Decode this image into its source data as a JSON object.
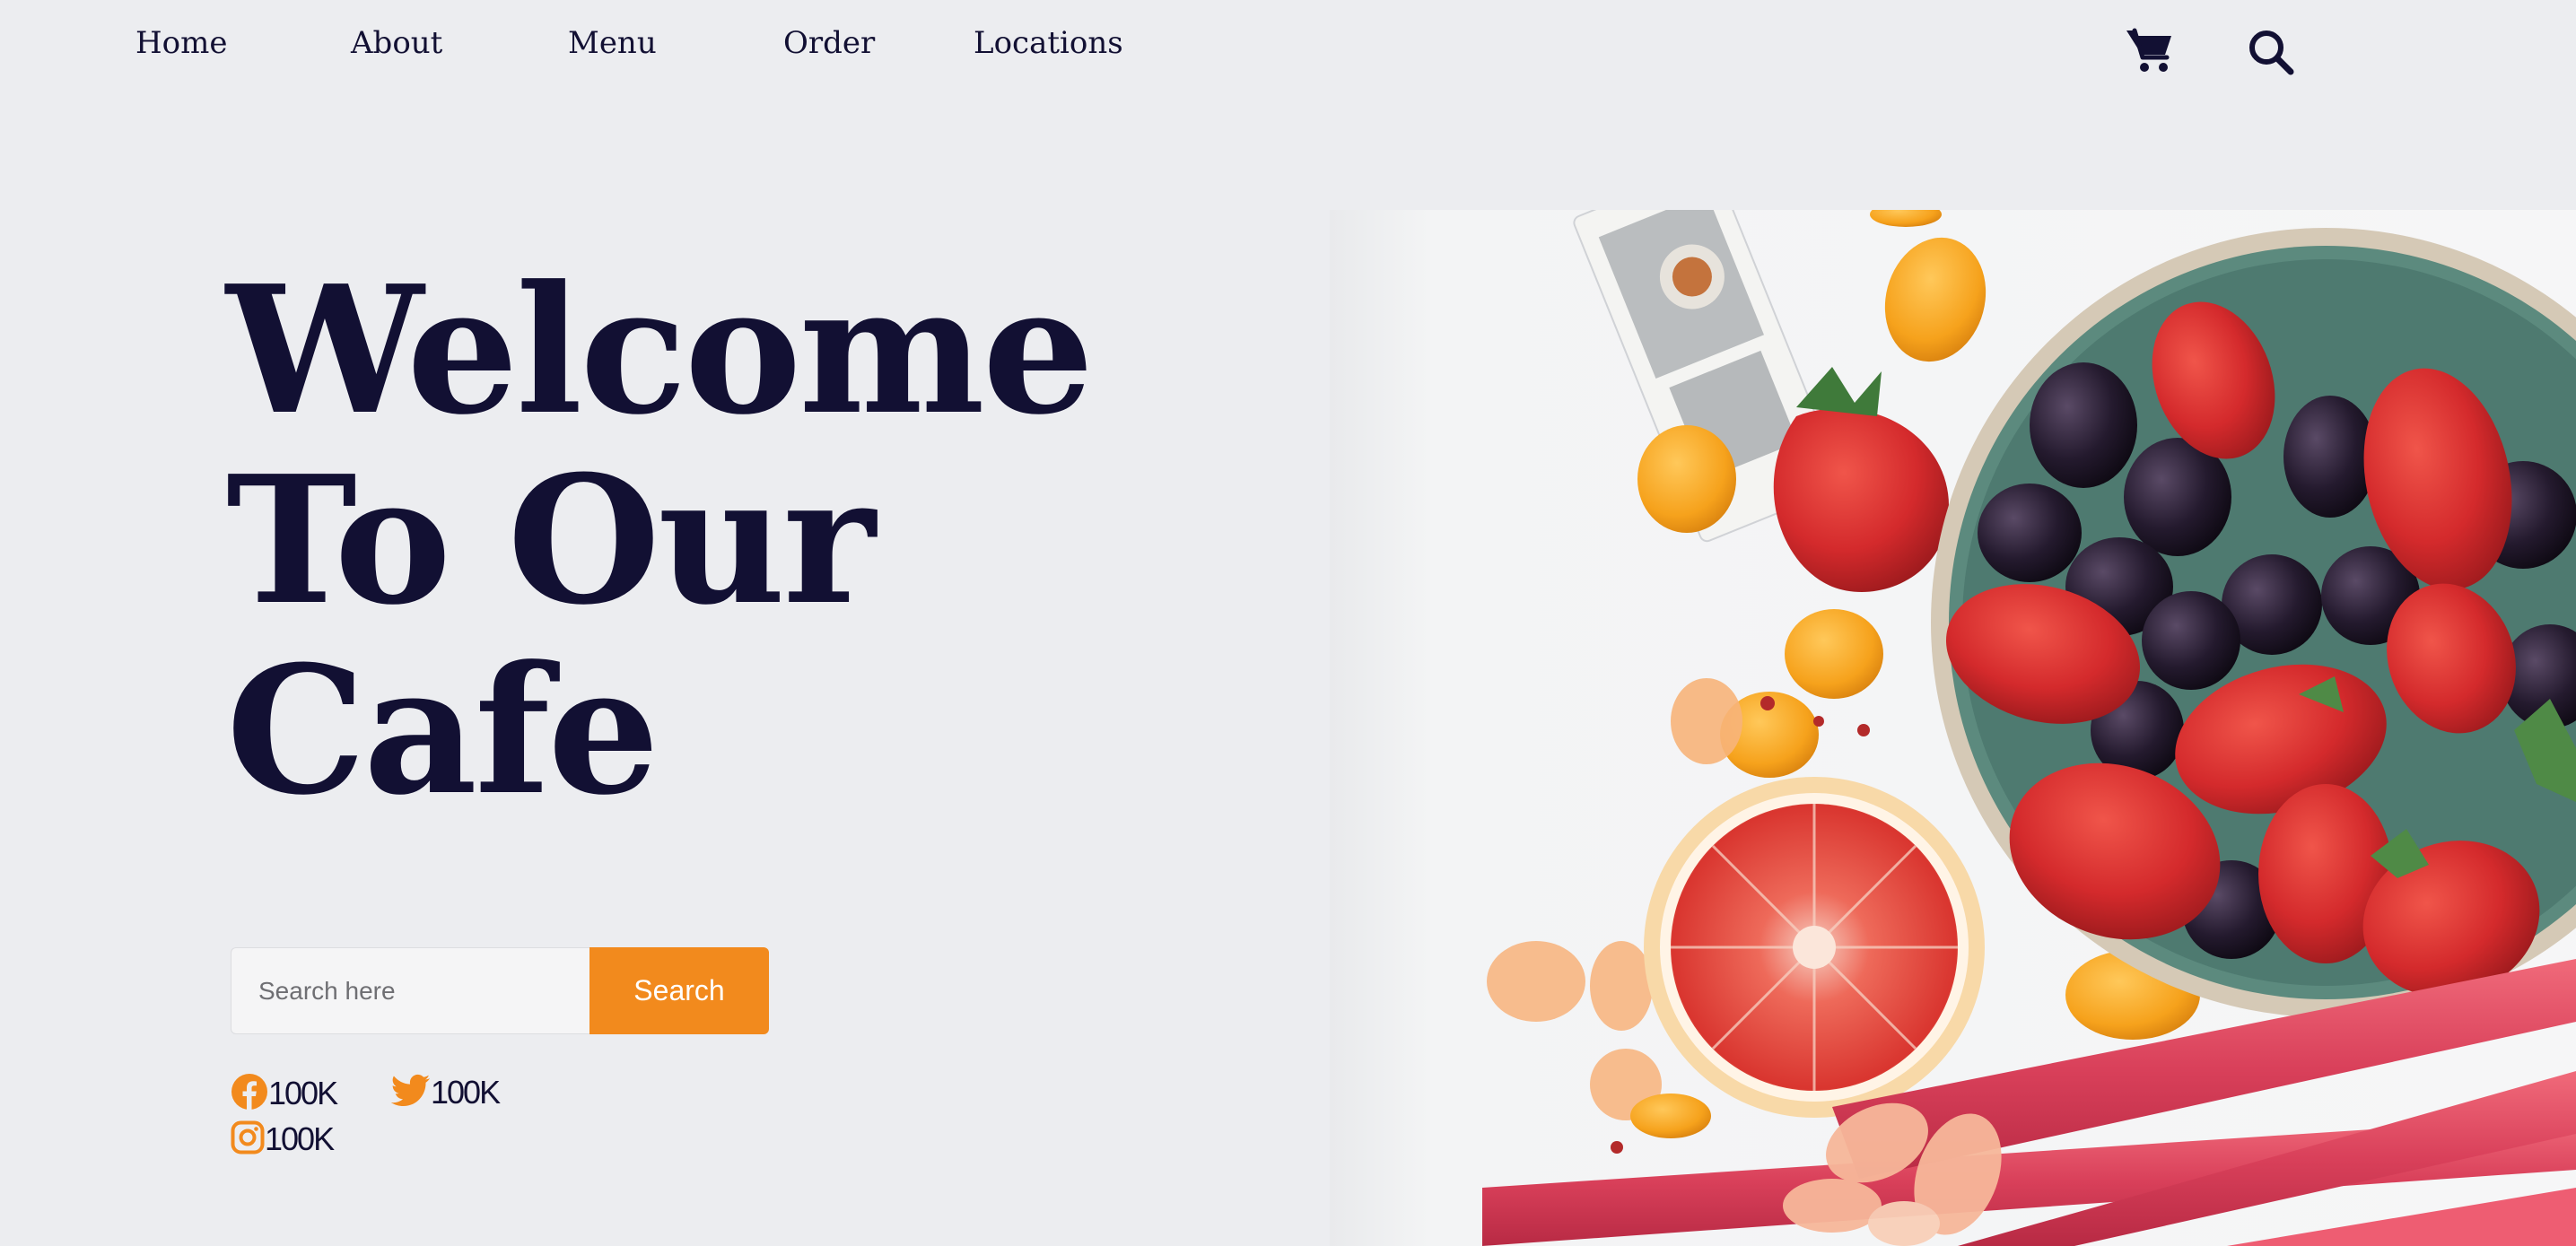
{
  "nav": {
    "links": [
      {
        "label": "Home"
      },
      {
        "label": "About"
      },
      {
        "label": "Menu"
      },
      {
        "label": "Order"
      },
      {
        "label": "Locations"
      }
    ],
    "cart_icon": "cart-icon",
    "search_icon": "search-icon"
  },
  "hero": {
    "headline_lines": [
      "Welcome",
      "To Our",
      "Cafe"
    ]
  },
  "search": {
    "placeholder": "Search here",
    "button_label": "Search"
  },
  "social": [
    {
      "icon": "facebook-icon",
      "count": "100K"
    },
    {
      "icon": "twitter-icon",
      "count": "100K"
    },
    {
      "icon": "instagram-icon",
      "count": "100K"
    }
  ],
  "image": {
    "subject": "fruit-bowl-photo"
  },
  "colors": {
    "background": "#ecedf0",
    "text": "#121033",
    "accent": "#f28a1d"
  }
}
